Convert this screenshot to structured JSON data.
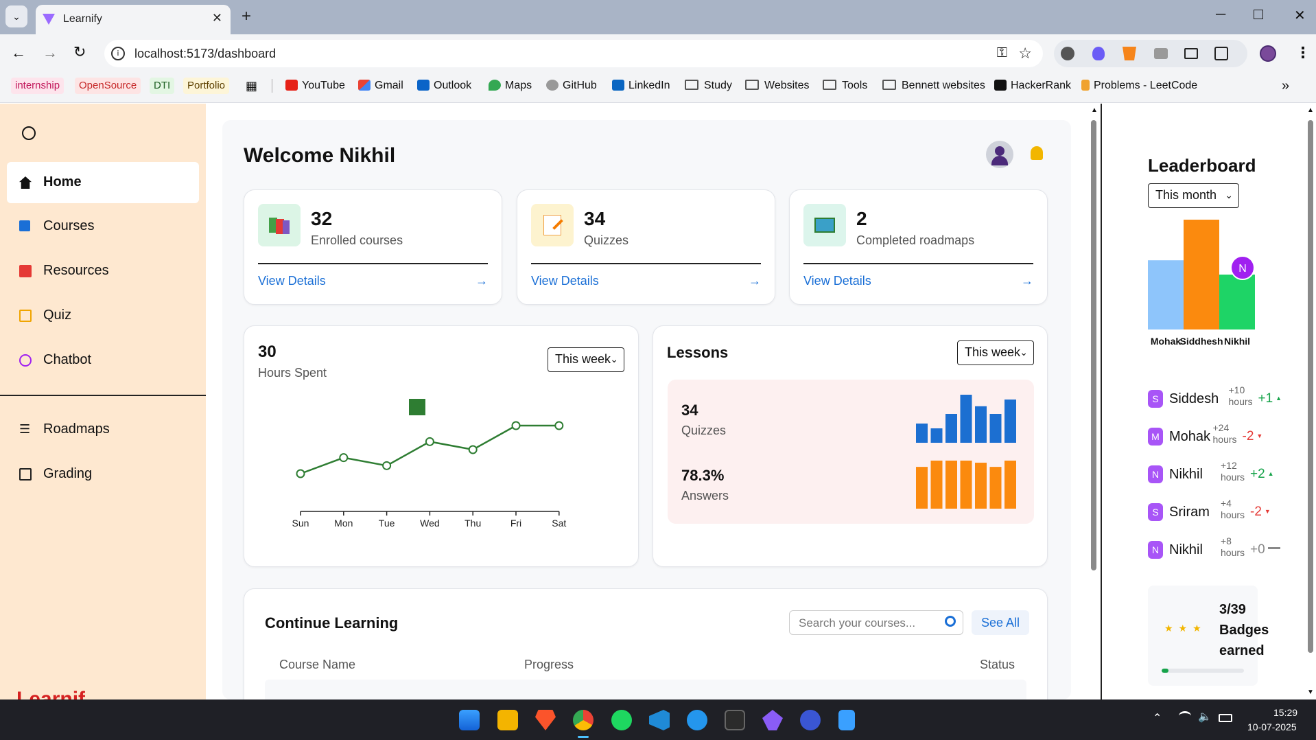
{
  "browser": {
    "tab_title": "Learnify",
    "url": "localhost:5173/dashboard",
    "bookmarks": [
      {
        "label": "internship",
        "color": "#c2185b",
        "bg": "#fde4ec"
      },
      {
        "label": "OpenSource",
        "color": "#c62828",
        "bg": "#fde4e4"
      },
      {
        "label": "DTI",
        "color": "#1b5e20",
        "bg": "#e3f6e3"
      },
      {
        "label": "Portfolio",
        "color": "#5d4000",
        "bg": "#fdf5d8"
      },
      {
        "label": "YouTube"
      },
      {
        "label": "Gmail"
      },
      {
        "label": "Outlook"
      },
      {
        "label": "Maps"
      },
      {
        "label": "GitHub"
      },
      {
        "label": "LinkedIn"
      },
      {
        "label": "Study"
      },
      {
        "label": "Websites"
      },
      {
        "label": "Tools"
      },
      {
        "label": "Bennett websites"
      },
      {
        "label": "HackerRank"
      },
      {
        "label": "Problems - LeetCode"
      }
    ]
  },
  "sidebar": {
    "items": [
      {
        "label": "Home",
        "icon": "home-icon",
        "active": true
      },
      {
        "label": "Courses",
        "icon": "square-icon"
      },
      {
        "label": "Resources",
        "icon": "list-icon"
      },
      {
        "label": "Quiz",
        "icon": "quiz-icon"
      },
      {
        "label": "Chatbot",
        "icon": "chat-icon"
      }
    ],
    "items2": [
      {
        "label": "Roadmaps",
        "icon": "list-icon"
      },
      {
        "label": "Grading",
        "icon": "clipboard-icon"
      }
    ],
    "brand": "Learnif"
  },
  "header": {
    "welcome": "Welcome Nikhil"
  },
  "stats": [
    {
      "value": "32",
      "label": "Enrolled courses",
      "link": "View Details",
      "arrow": "→",
      "icon": "books-icon"
    },
    {
      "value": "34",
      "label": "Quizzes",
      "link": "View Details",
      "arrow": "→",
      "icon": "notepad-icon"
    },
    {
      "value": "2",
      "label": "Completed roadmaps",
      "link": "View Details",
      "arrow": "→",
      "icon": "map-icon"
    }
  ],
  "hours": {
    "value": "30",
    "label": "Hours Spent",
    "filter": "This week"
  },
  "chart_data": {
    "type": "line",
    "categories": [
      "Sun",
      "Mon",
      "Tue",
      "Wed",
      "Thu",
      "Fri",
      "Sat"
    ],
    "values": [
      1.5,
      2.5,
      2.0,
      3.5,
      3.0,
      4.5,
      4.5
    ],
    "ylim": [
      0,
      6
    ],
    "color": "#2e7d32"
  },
  "lessons": {
    "title": "Lessons",
    "filter": "This week",
    "quizzes_value": "34",
    "quizzes_label": "Quizzes",
    "answers_value": "78.3%",
    "answers_label": "Answers",
    "quiz_bars": [
      2,
      1.5,
      3,
      5,
      3.8,
      3,
      4.5
    ],
    "answer_bars": [
      4,
      4.6,
      4.6,
      4.6,
      4.4,
      4,
      4.6
    ]
  },
  "continue": {
    "title": "Continue Learning",
    "search_placeholder": "Search your courses...",
    "see_all": "See All",
    "columns": [
      "Course Name",
      "Progress",
      "Status"
    ]
  },
  "leaderboard": {
    "title": "Leaderboard",
    "filter": "This month",
    "podium": [
      {
        "name": "Mohak",
        "level": 0.63,
        "color": "#8ec5fb"
      },
      {
        "name": "Siddhesh",
        "level": 1.0,
        "color": "#fb8a0e"
      },
      {
        "name": "Nikhil",
        "level": 0.5,
        "color": "#1ed466"
      }
    ],
    "marker": "N",
    "rows": [
      {
        "initial": "S",
        "name": "Siddesh",
        "hours": "+10",
        "unit": "hours",
        "change": "+1",
        "dir": "up",
        "color": "#a855f7"
      },
      {
        "initial": "M",
        "name": "Mohak",
        "hours": "+24",
        "unit": "hours",
        "change": "-2",
        "dir": "down",
        "color": "#a855f7"
      },
      {
        "initial": "N",
        "name": "Nikhil",
        "hours": "+12",
        "unit": "hours",
        "change": "+2",
        "dir": "up",
        "color": "#a855f7"
      },
      {
        "initial": "S",
        "name": "Sriram",
        "hours": "+4",
        "unit": "hours",
        "change": "-2",
        "dir": "down",
        "color": "#a855f7"
      },
      {
        "initial": "N",
        "name": "Nikhil",
        "hours": "+8",
        "unit": "hours",
        "change": "+0",
        "dir": "none",
        "color": "#a855f7"
      }
    ],
    "badges": {
      "count": "3/39",
      "label1": "Badges",
      "label2": "earned",
      "progress": 0.08
    }
  },
  "taskbar": {
    "time": "15:29",
    "date": "10-07-2025"
  }
}
